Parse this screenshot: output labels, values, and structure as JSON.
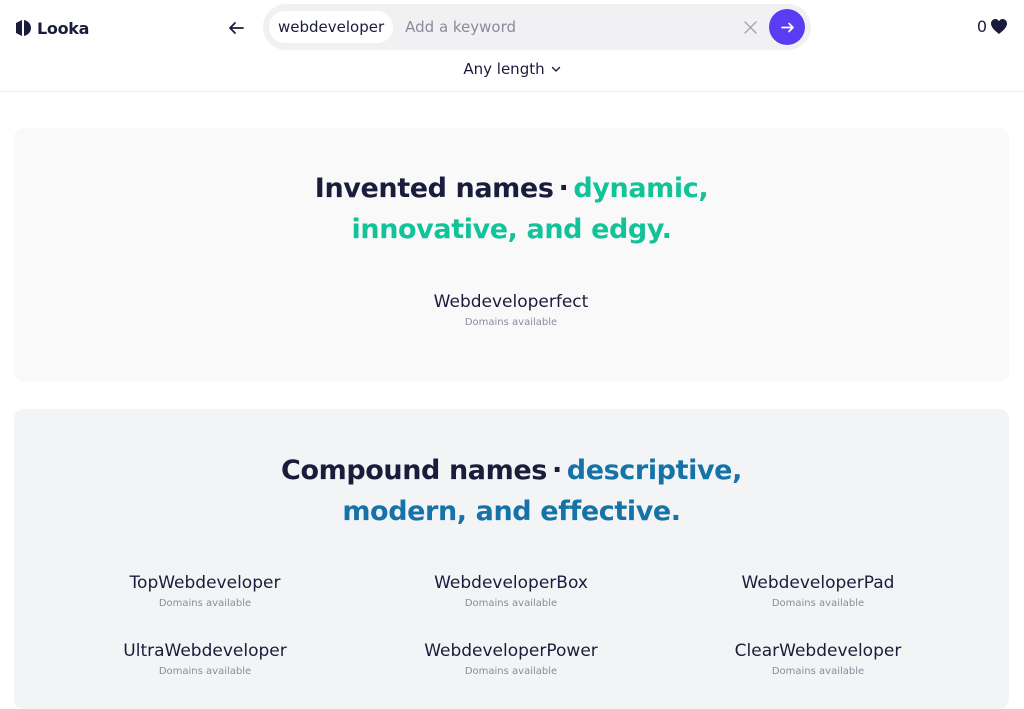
{
  "header": {
    "logo_text": "Looka",
    "search": {
      "chip": "webdeveloper",
      "placeholder": "Add a keyword",
      "value": ""
    },
    "favorites_count": "0",
    "length_filter": "Any length"
  },
  "sections": [
    {
      "title": "Invented names",
      "accent_line1": "dynamic,",
      "accent_line2": "innovative, and edgy.",
      "names": [
        {
          "name": "Webdeveloperfect",
          "status": "Domains available"
        }
      ]
    },
    {
      "title": "Compound names",
      "accent_line1": "descriptive,",
      "accent_line2": "modern, and effective.",
      "names": [
        {
          "name": "TopWebdeveloper",
          "status": "Domains available"
        },
        {
          "name": "WebdeveloperBox",
          "status": "Domains available"
        },
        {
          "name": "WebdeveloperPad",
          "status": "Domains available"
        },
        {
          "name": "UltraWebdeveloper",
          "status": "Domains available"
        },
        {
          "name": "WebdeveloperPower",
          "status": "Domains available"
        },
        {
          "name": "ClearWebdeveloper",
          "status": "Domains available"
        }
      ]
    }
  ],
  "colors": {
    "brand_purple": "#5a3cf2",
    "accent_green": "#12c39a",
    "accent_blue": "#1673a8",
    "text_dark": "#1a1c3b"
  },
  "icons": {
    "logo": "looka-logo-icon",
    "back": "arrow-left-icon",
    "clear": "close-icon",
    "submit": "arrow-right-icon",
    "favorites": "heart-icon",
    "dropdown": "chevron-down-icon"
  }
}
